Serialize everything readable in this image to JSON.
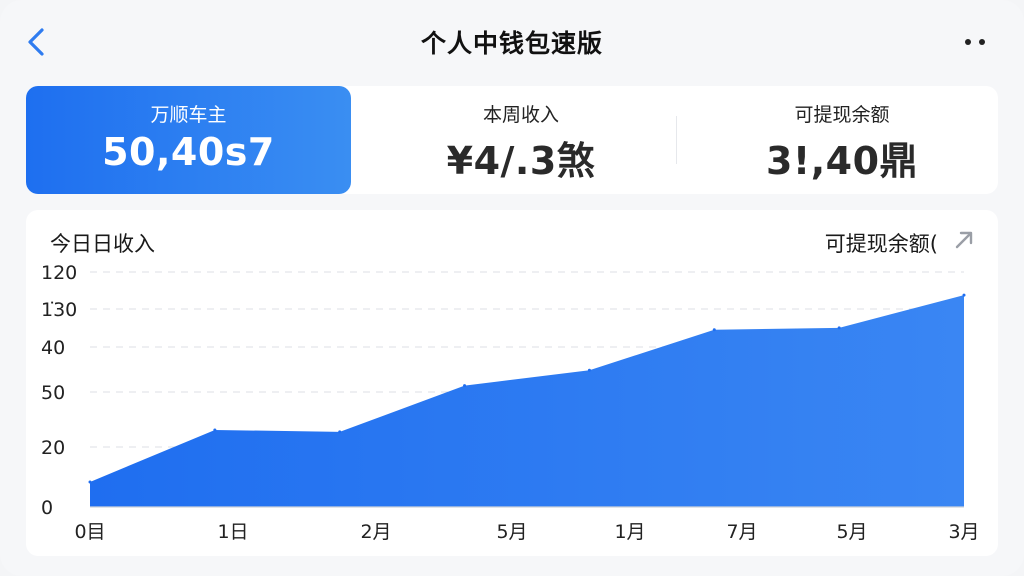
{
  "header": {
    "title": "个人中钱包速版",
    "back_icon": "chevron-left-icon",
    "more_icon": "more-dots-icon"
  },
  "stats": [
    {
      "label": "万顺车主",
      "value": "50,40s7"
    },
    {
      "label": "本周收入",
      "value": "¥4/.3煞"
    },
    {
      "label": "可提现余额",
      "value": "3!,40鼎"
    }
  ],
  "chart_header": {
    "title": "今日日收入",
    "action": "可提现余额(",
    "action_icon": "expand-arrow-icon"
  },
  "colors": {
    "accent": "#1e6ff0",
    "area_fill": "#2f7cf0"
  },
  "chart_data": {
    "type": "area",
    "y_tick_labels": [
      "120",
      "1͘30",
      "40",
      "50",
      "20",
      "0"
    ],
    "categories": [
      "0目",
      "1日",
      "2月",
      "5月",
      "1月",
      "7月",
      "5月",
      "3月"
    ],
    "values": [
      13,
      40,
      39,
      63,
      71,
      92,
      93,
      110
    ],
    "ylim": [
      0,
      122
    ],
    "grid": true
  }
}
